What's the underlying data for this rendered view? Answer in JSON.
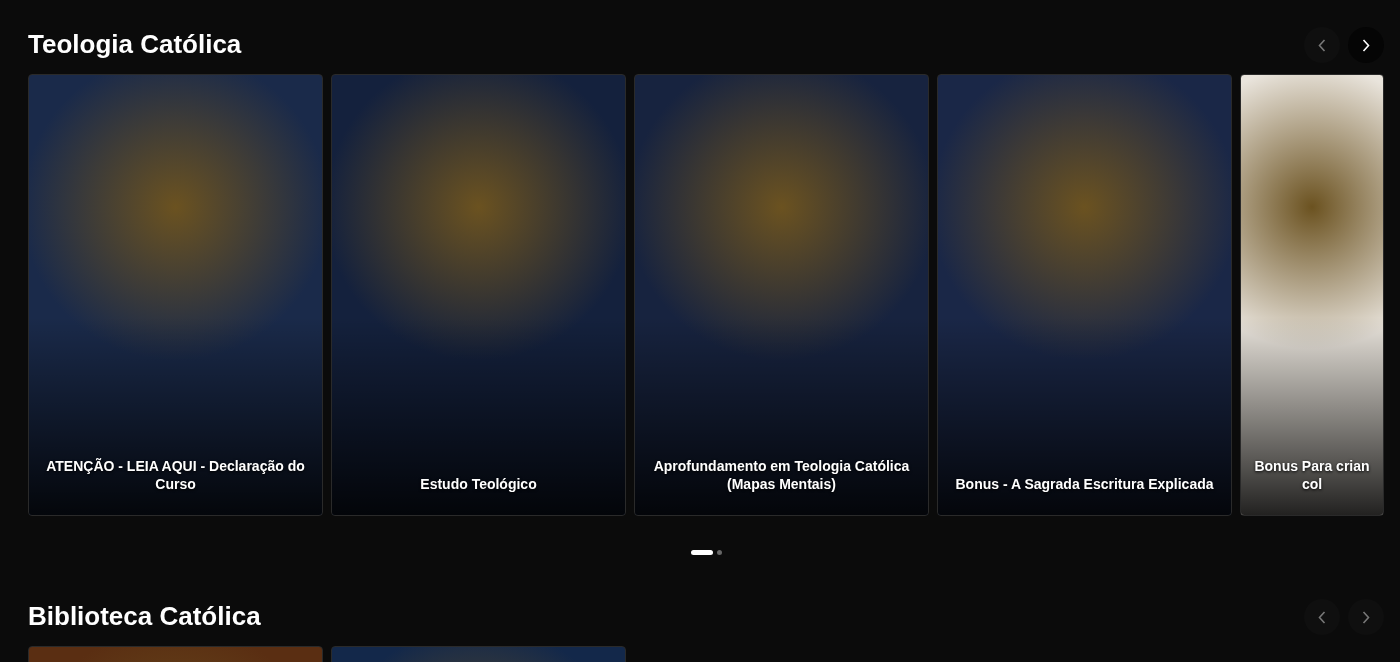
{
  "sections": [
    {
      "title": "Teologia Católica",
      "prev_disabled": true,
      "next_disabled": false,
      "cards": [
        {
          "caption": "ATENÇÃO - LEIA AQUI - Declaração do Curso",
          "color": "#1a2a4a"
        },
        {
          "caption": "Estudo Teológico",
          "color": "#14213d"
        },
        {
          "caption": "Aprofundamento em Teologia Católica (Mapas Mentais)",
          "color": "#17233f"
        },
        {
          "caption": "Bonus - A Sagrada Escritura Explicada",
          "color": "#1a2747"
        },
        {
          "caption": "Bonus Para crian col",
          "color": "#e9e4dc"
        }
      ],
      "dots": [
        {
          "selected": true
        },
        {
          "selected": false
        }
      ]
    },
    {
      "title": "Biblioteca Católica",
      "prev_disabled": true,
      "next_disabled": true,
      "cards": [
        {
          "color": "#5a2e12"
        },
        {
          "color": "#13284a"
        }
      ]
    }
  ]
}
